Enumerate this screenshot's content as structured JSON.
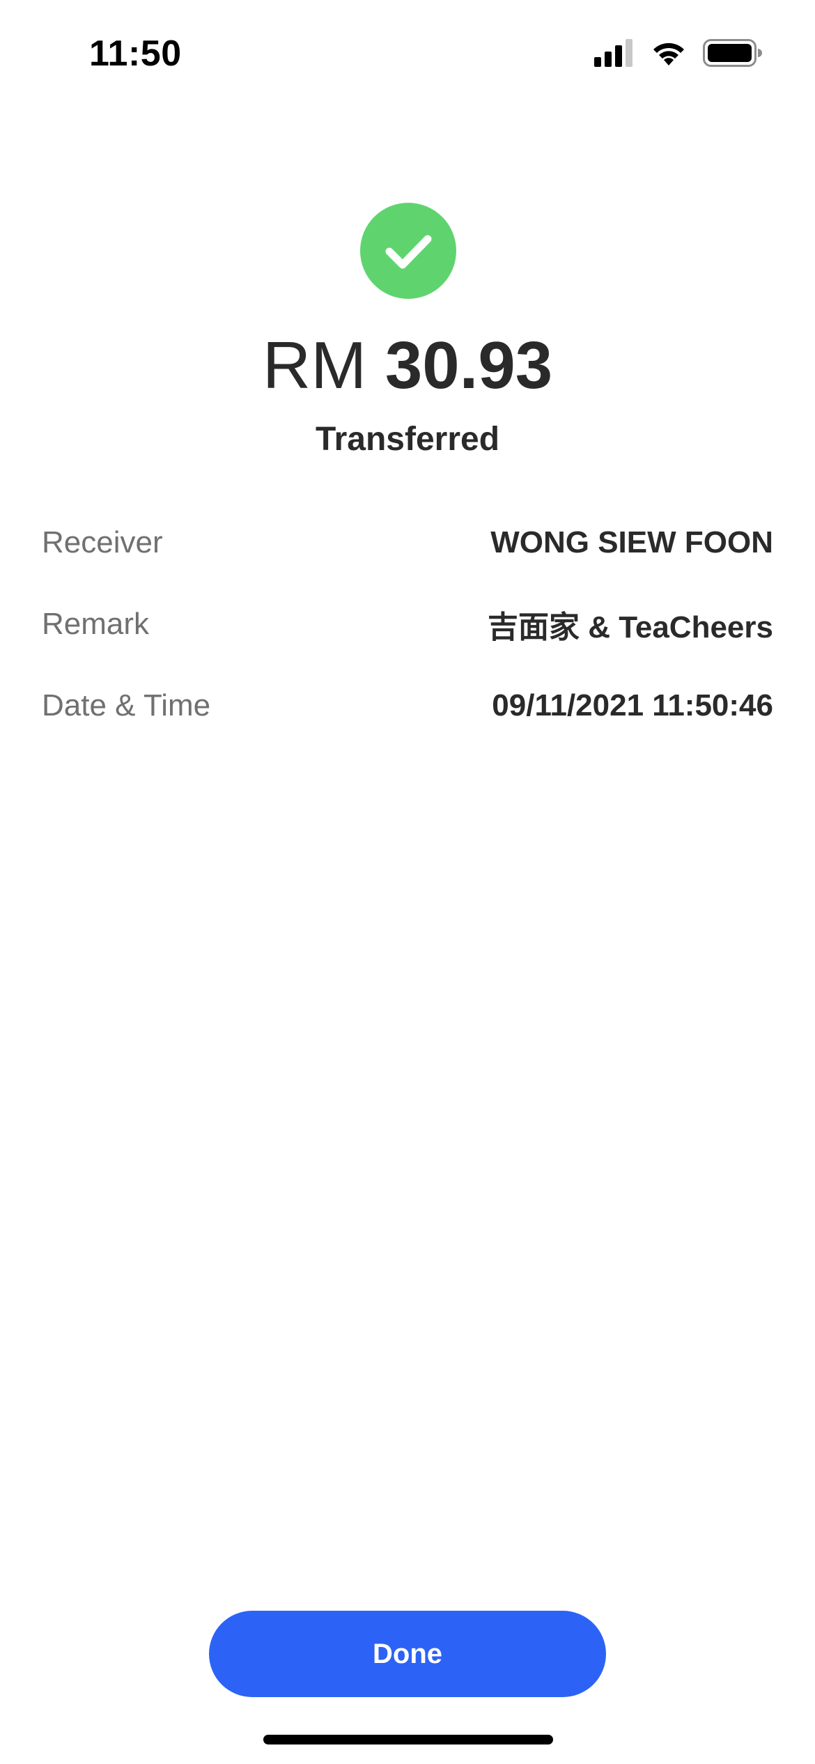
{
  "status_bar": {
    "time": "11:50",
    "icons": [
      "cellular-signal-icon",
      "wifi-icon",
      "battery-icon"
    ]
  },
  "success": {
    "icon": "checkmark-icon",
    "icon_color": "#5fd46e"
  },
  "amount": {
    "currency": "RM",
    "value": "30.93"
  },
  "status_label": "Transferred",
  "details": [
    {
      "label": "Receiver",
      "value": "WONG SIEW FOON"
    },
    {
      "label": "Remark",
      "value": "吉面家 & TeaCheers"
    },
    {
      "label": "Date & Time",
      "value": "09/11/2021 11:50:46"
    }
  ],
  "done_button": {
    "label": "Done",
    "color": "#2c63f6"
  }
}
